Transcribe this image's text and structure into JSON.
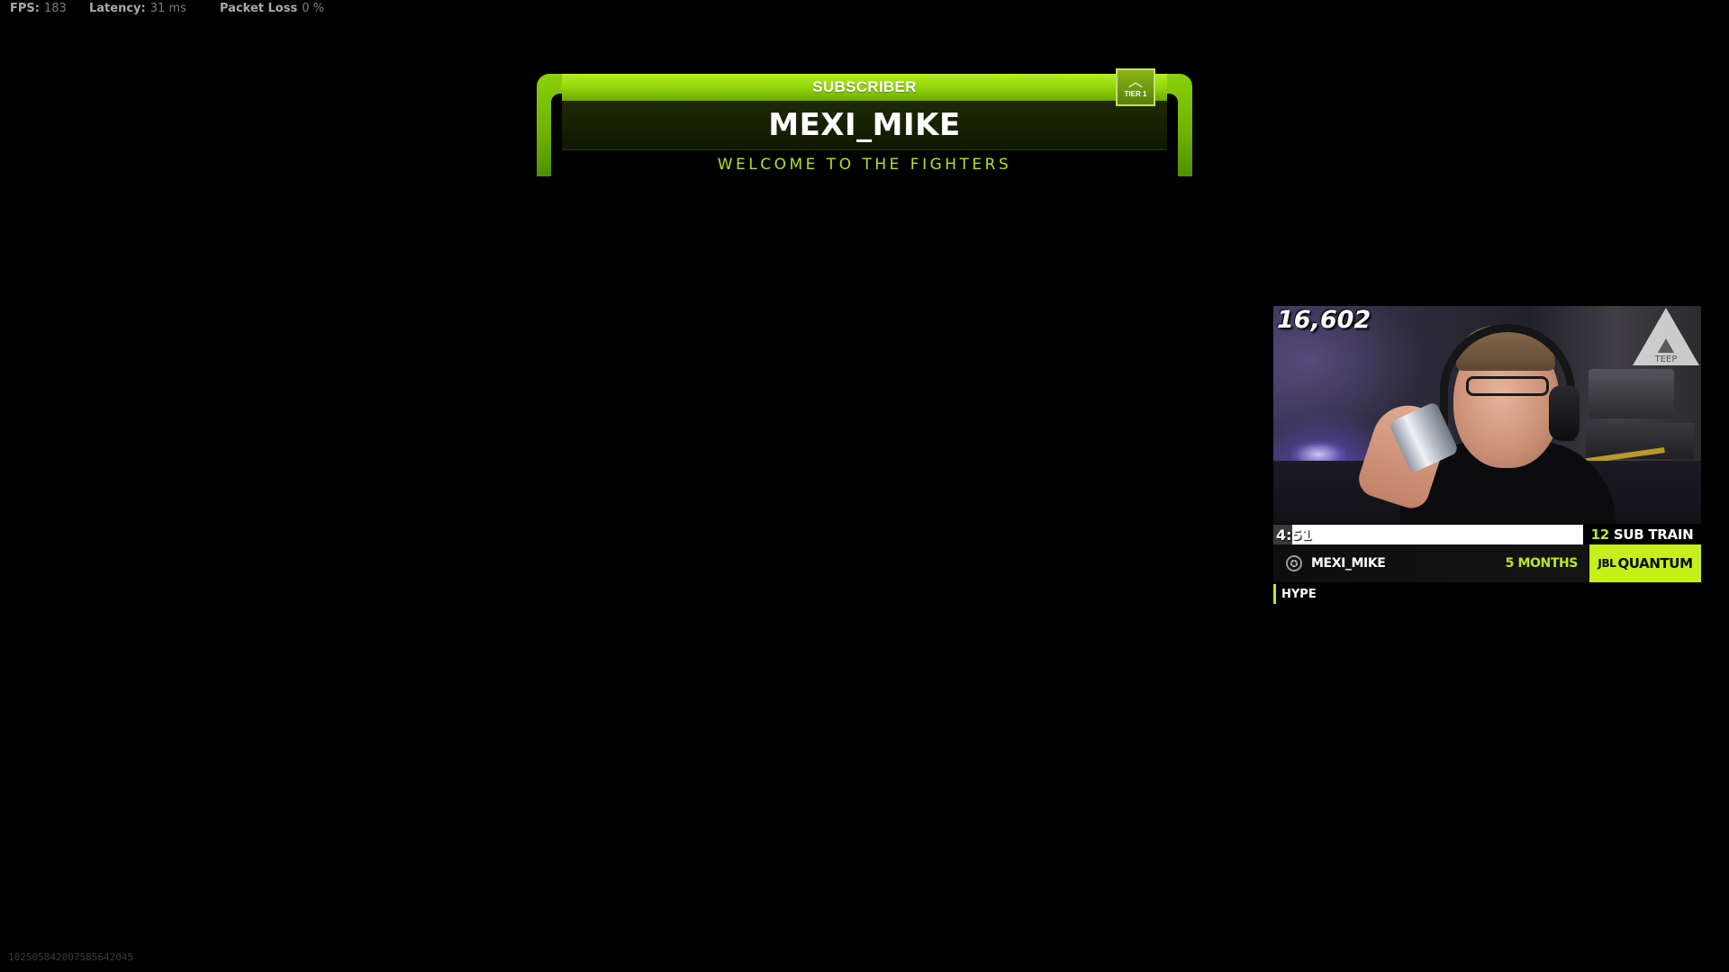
{
  "stats": {
    "fps_label": "FPS:",
    "fps_value": "183",
    "latency_label": "Latency:",
    "latency_value": "31 ms",
    "packet_loss_label": "Packet Loss",
    "packet_loss_value": "0 %"
  },
  "alert": {
    "type": "SUBSCRIBER",
    "username": "MEXI_MIKE",
    "message": "WELCOME TO THE FIGHTERS",
    "tier_label": "TIER 1",
    "tier_icon": "chevron-up-icon"
  },
  "webcam": {
    "viewer_count": "16,602",
    "logo_icon": "triangle-logo-icon",
    "logo_text": "TEEP"
  },
  "sub_train": {
    "timer": "4:51",
    "progress_fraction": 0.06,
    "count": "12",
    "label": "SUB TRAIN"
  },
  "latest_sub": {
    "icon": "badge-icon",
    "name": "MEXI_MIKE",
    "months": "5 MONTHS"
  },
  "sponsor": {
    "brand_prefix": "JBL",
    "brand": "QUANTUM"
  },
  "hype": {
    "label": "HYPE"
  },
  "session_id": "10250584200758564204​5",
  "colors": {
    "accent": "#b7ec1e",
    "banner_green": "#8fd20b",
    "background": "#000000"
  }
}
